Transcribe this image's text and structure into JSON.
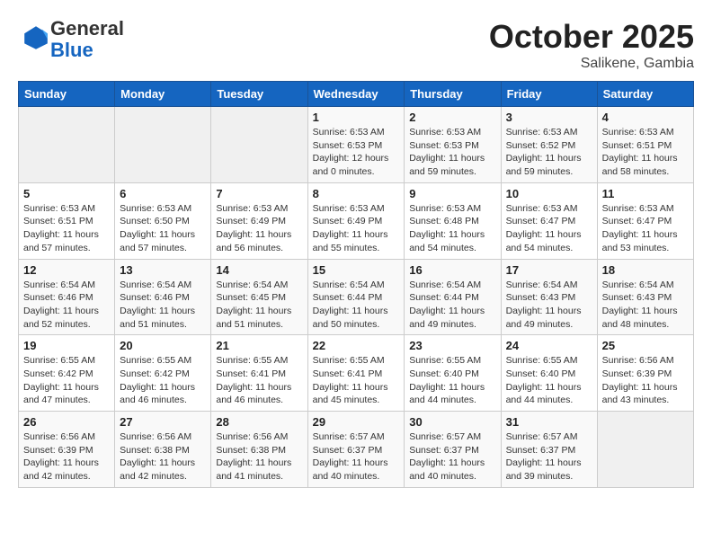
{
  "header": {
    "logo_general": "General",
    "logo_blue": "Blue",
    "month": "October 2025",
    "location": "Salikene, Gambia"
  },
  "days_of_week": [
    "Sunday",
    "Monday",
    "Tuesday",
    "Wednesday",
    "Thursday",
    "Friday",
    "Saturday"
  ],
  "weeks": [
    [
      {
        "day": "",
        "info": ""
      },
      {
        "day": "",
        "info": ""
      },
      {
        "day": "",
        "info": ""
      },
      {
        "day": "1",
        "info": "Sunrise: 6:53 AM\nSunset: 6:53 PM\nDaylight: 12 hours\nand 0 minutes."
      },
      {
        "day": "2",
        "info": "Sunrise: 6:53 AM\nSunset: 6:53 PM\nDaylight: 11 hours\nand 59 minutes."
      },
      {
        "day": "3",
        "info": "Sunrise: 6:53 AM\nSunset: 6:52 PM\nDaylight: 11 hours\nand 59 minutes."
      },
      {
        "day": "4",
        "info": "Sunrise: 6:53 AM\nSunset: 6:51 PM\nDaylight: 11 hours\nand 58 minutes."
      }
    ],
    [
      {
        "day": "5",
        "info": "Sunrise: 6:53 AM\nSunset: 6:51 PM\nDaylight: 11 hours\nand 57 minutes."
      },
      {
        "day": "6",
        "info": "Sunrise: 6:53 AM\nSunset: 6:50 PM\nDaylight: 11 hours\nand 57 minutes."
      },
      {
        "day": "7",
        "info": "Sunrise: 6:53 AM\nSunset: 6:49 PM\nDaylight: 11 hours\nand 56 minutes."
      },
      {
        "day": "8",
        "info": "Sunrise: 6:53 AM\nSunset: 6:49 PM\nDaylight: 11 hours\nand 55 minutes."
      },
      {
        "day": "9",
        "info": "Sunrise: 6:53 AM\nSunset: 6:48 PM\nDaylight: 11 hours\nand 54 minutes."
      },
      {
        "day": "10",
        "info": "Sunrise: 6:53 AM\nSunset: 6:47 PM\nDaylight: 11 hours\nand 54 minutes."
      },
      {
        "day": "11",
        "info": "Sunrise: 6:53 AM\nSunset: 6:47 PM\nDaylight: 11 hours\nand 53 minutes."
      }
    ],
    [
      {
        "day": "12",
        "info": "Sunrise: 6:54 AM\nSunset: 6:46 PM\nDaylight: 11 hours\nand 52 minutes."
      },
      {
        "day": "13",
        "info": "Sunrise: 6:54 AM\nSunset: 6:46 PM\nDaylight: 11 hours\nand 51 minutes."
      },
      {
        "day": "14",
        "info": "Sunrise: 6:54 AM\nSunset: 6:45 PM\nDaylight: 11 hours\nand 51 minutes."
      },
      {
        "day": "15",
        "info": "Sunrise: 6:54 AM\nSunset: 6:44 PM\nDaylight: 11 hours\nand 50 minutes."
      },
      {
        "day": "16",
        "info": "Sunrise: 6:54 AM\nSunset: 6:44 PM\nDaylight: 11 hours\nand 49 minutes."
      },
      {
        "day": "17",
        "info": "Sunrise: 6:54 AM\nSunset: 6:43 PM\nDaylight: 11 hours\nand 49 minutes."
      },
      {
        "day": "18",
        "info": "Sunrise: 6:54 AM\nSunset: 6:43 PM\nDaylight: 11 hours\nand 48 minutes."
      }
    ],
    [
      {
        "day": "19",
        "info": "Sunrise: 6:55 AM\nSunset: 6:42 PM\nDaylight: 11 hours\nand 47 minutes."
      },
      {
        "day": "20",
        "info": "Sunrise: 6:55 AM\nSunset: 6:42 PM\nDaylight: 11 hours\nand 46 minutes."
      },
      {
        "day": "21",
        "info": "Sunrise: 6:55 AM\nSunset: 6:41 PM\nDaylight: 11 hours\nand 46 minutes."
      },
      {
        "day": "22",
        "info": "Sunrise: 6:55 AM\nSunset: 6:41 PM\nDaylight: 11 hours\nand 45 minutes."
      },
      {
        "day": "23",
        "info": "Sunrise: 6:55 AM\nSunset: 6:40 PM\nDaylight: 11 hours\nand 44 minutes."
      },
      {
        "day": "24",
        "info": "Sunrise: 6:55 AM\nSunset: 6:40 PM\nDaylight: 11 hours\nand 44 minutes."
      },
      {
        "day": "25",
        "info": "Sunrise: 6:56 AM\nSunset: 6:39 PM\nDaylight: 11 hours\nand 43 minutes."
      }
    ],
    [
      {
        "day": "26",
        "info": "Sunrise: 6:56 AM\nSunset: 6:39 PM\nDaylight: 11 hours\nand 42 minutes."
      },
      {
        "day": "27",
        "info": "Sunrise: 6:56 AM\nSunset: 6:38 PM\nDaylight: 11 hours\nand 42 minutes."
      },
      {
        "day": "28",
        "info": "Sunrise: 6:56 AM\nSunset: 6:38 PM\nDaylight: 11 hours\nand 41 minutes."
      },
      {
        "day": "29",
        "info": "Sunrise: 6:57 AM\nSunset: 6:37 PM\nDaylight: 11 hours\nand 40 minutes."
      },
      {
        "day": "30",
        "info": "Sunrise: 6:57 AM\nSunset: 6:37 PM\nDaylight: 11 hours\nand 40 minutes."
      },
      {
        "day": "31",
        "info": "Sunrise: 6:57 AM\nSunset: 6:37 PM\nDaylight: 11 hours\nand 39 minutes."
      },
      {
        "day": "",
        "info": ""
      }
    ]
  ]
}
